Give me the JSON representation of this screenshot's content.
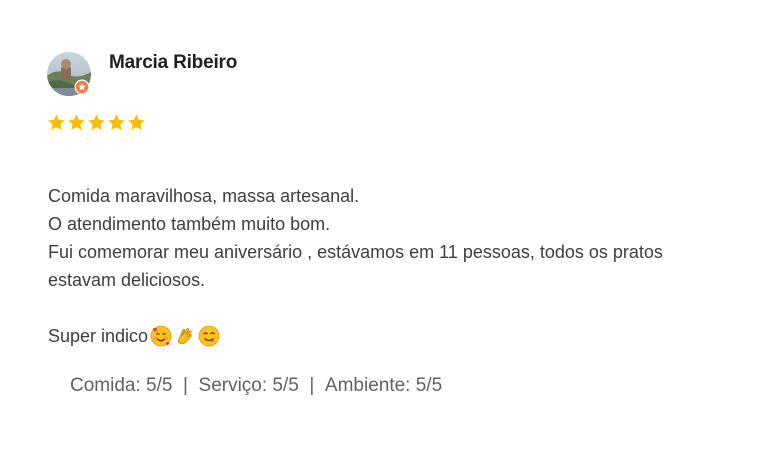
{
  "reviewer": {
    "name": "Marcia Ribeiro",
    "avatar_icon": "avatar-photo",
    "badge_icon": "local-guide-badge-icon",
    "badge_color": "#f57c4c"
  },
  "rating": {
    "stars": 5,
    "max": 5,
    "star_color": "#fbbc04"
  },
  "review_text": {
    "line1": "Comida maravilhosa, massa artesanal.",
    "line2": "O atendimento também muito bom.",
    "line3": "Fui comemorar meu aniversário , estávamos em 11 pessoas, todos os pratos",
    "line4": "estavam deliciosos.",
    "line5": "Super indico",
    "emojis": [
      "smiling-face-with-hearts-icon",
      "clapping-hands-icon",
      "face-savoring-food-icon"
    ]
  },
  "sub_ratings": {
    "food": "Comida: 5/5",
    "service": "Serviço: 5/5",
    "ambience": "Ambiente: 5/5",
    "separator": "|"
  }
}
